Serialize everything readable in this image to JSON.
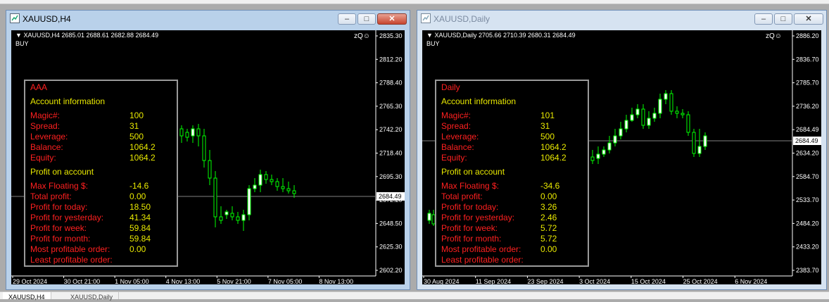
{
  "windows": [
    {
      "title": "XAUUSD,H4",
      "header": "XAUUSD,H4  2685.01 2688.61 2682.88 2684.49",
      "signal": "BUY",
      "zq": "zQ",
      "price_label": "2684.49",
      "y_axis": [
        "2835.30",
        "2812.20",
        "2788.40",
        "2765.30",
        "2742.20",
        "2718.40",
        "2695.30",
        "2672.20",
        "2648.50",
        "2625.30",
        "2602.20"
      ],
      "x_axis": [
        "29 Oct 2024",
        "30 Oct 21:00",
        "1 Nov 05:00",
        "4 Nov 13:00",
        "5 Nov 21:00",
        "7 Nov 05:00",
        "8 Nov 13:00"
      ],
      "panel": {
        "name": "AAA",
        "account_heading": "Account information",
        "account_rows": [
          {
            "label": "Magic#:",
            "value": "100"
          },
          {
            "label": "Spread:",
            "value": "31"
          },
          {
            "label": "Leverage:",
            "value": "500"
          },
          {
            "label": "Balance:",
            "value": "1064.2"
          },
          {
            "label": "Equity:",
            "value": "1064.2"
          }
        ],
        "profit_heading": "Profit on account",
        "profit_rows": [
          {
            "label": "Max Floating $:",
            "value": "-14.6"
          },
          {
            "label": "Total profit:",
            "value": "0.00"
          },
          {
            "label": "Profit for today:",
            "value": "18.50"
          },
          {
            "label": "Profit for yesterday:",
            "value": "41.34"
          },
          {
            "label": "Profit for week:",
            "value": "59.84"
          },
          {
            "label": "Profit for month:",
            "value": "59.84"
          },
          {
            "label": "Most profitable order:",
            "value": "0.00"
          },
          {
            "label": "Least profitable order:",
            "value": ""
          }
        ]
      }
    },
    {
      "title": "XAUUSD,Daily",
      "header": "XAUUSD,Daily  2705.66 2710.39 2680.31 2684.49",
      "signal": "BUY",
      "zq": "zQ",
      "price_label": "2684.49",
      "y_axis": [
        "2886.20",
        "2836.70",
        "2785.70",
        "2736.20",
        "2684.49",
        "2634.20",
        "2584.70",
        "2533.70",
        "2484.20",
        "2433.20",
        "2383.70"
      ],
      "x_axis": [
        "30 Aug 2024",
        "11 Sep 2024",
        "23 Sep 2024",
        "3 Oct 2024",
        "15 Oct 2024",
        "25 Oct 2024",
        "6 Nov 2024"
      ],
      "panel": {
        "name": "Daily",
        "account_heading": "Account information",
        "account_rows": [
          {
            "label": "Magic#:",
            "value": "101"
          },
          {
            "label": "Spread:",
            "value": "31"
          },
          {
            "label": "Leverage:",
            "value": "500"
          },
          {
            "label": "Balance:",
            "value": "1064.2"
          },
          {
            "label": "Equity:",
            "value": "1064.2"
          }
        ],
        "profit_heading": "Profit on account",
        "profit_rows": [
          {
            "label": "Max Floating $:",
            "value": "-34.6"
          },
          {
            "label": "Total profit:",
            "value": "0.00"
          },
          {
            "label": "Profit for today:",
            "value": "3.26"
          },
          {
            "label": "Profit for yesterday:",
            "value": "2.46"
          },
          {
            "label": "Profit for week:",
            "value": "5.72"
          },
          {
            "label": "Profit for month:",
            "value": "5.72"
          },
          {
            "label": "Most profitable order:",
            "value": "0.00"
          },
          {
            "label": "Least profitable order:",
            "value": ""
          }
        ]
      }
    }
  ],
  "tabs": [
    {
      "label": "XAUUSD,H4"
    },
    {
      "label": "XAUUSD,Daily"
    }
  ],
  "colors": {
    "bull_candle": "#ffffff",
    "bear_candle": "#000000",
    "wick": "#00ff00",
    "price_line": "#808080",
    "panel_label": "#ff2020",
    "panel_value": "#e8e800"
  }
}
